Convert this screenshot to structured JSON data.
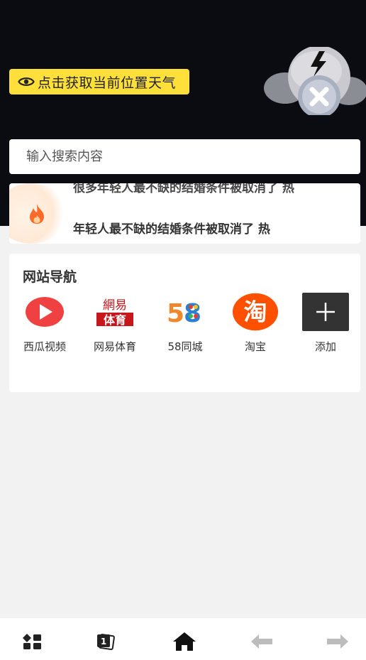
{
  "status_bar": {
    "left": "",
    "right": ""
  },
  "weather": {
    "location_button": "点击获取当前位置天气",
    "icon": "cloud-error-icon"
  },
  "search": {
    "placeholder": "输入搜索内容"
  },
  "hot_news": {
    "icon": "fire-icon",
    "items": [
      "很多年轻人最不缺的结婚条件被取消了 热",
      "年轻人最不缺的结婚条件被取消了  热"
    ]
  },
  "site_nav": {
    "title": "网站导航",
    "sites": [
      {
        "label": "西瓜视频",
        "icon": "xigua-video-icon"
      },
      {
        "label": "网易体育",
        "icon": "netease-sports-icon"
      },
      {
        "label": "58同城",
        "icon": "58-icon"
      },
      {
        "label": "淘宝",
        "icon": "taobao-icon"
      },
      {
        "label": "添加",
        "icon": "add-icon"
      }
    ]
  },
  "tab_bar": {
    "items": [
      "menu-icon",
      "tabs-icon",
      "home-icon",
      "back-icon",
      "forward-icon"
    ],
    "tab_count": "1"
  },
  "colors": {
    "accent_yellow": "#ffe03a",
    "hero_bg": "#0b0b12",
    "xigua_red": "#f04142",
    "taobao_orange": "#ff5000"
  }
}
